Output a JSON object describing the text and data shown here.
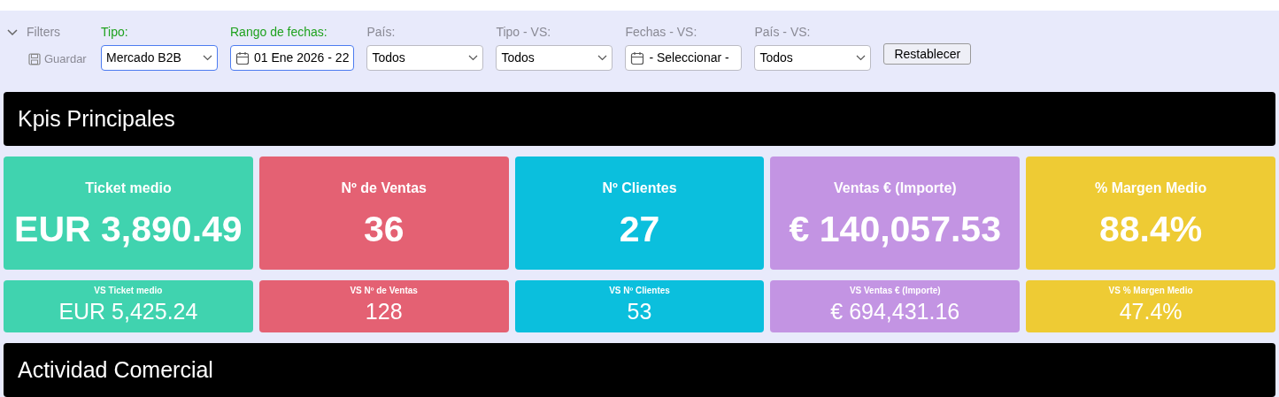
{
  "filters": {
    "toggle_label": "Filters",
    "save_label": "Guardar",
    "expanded": true,
    "fields": [
      {
        "kind": "select",
        "label": "Tipo:",
        "value": "Mercado B2B",
        "active": true
      },
      {
        "kind": "date",
        "label": "Rango de fechas:",
        "value": "01 Ene 2026 - 22",
        "active": true
      },
      {
        "kind": "select",
        "label": "País:",
        "value": "Todos",
        "active": false
      },
      {
        "kind": "select",
        "label": "Tipo - VS:",
        "value": "Todos",
        "active": false
      },
      {
        "kind": "date",
        "label": "Fechas - VS:",
        "value": "- Seleccionar -",
        "active": false
      },
      {
        "kind": "select",
        "label": "País - VS:",
        "value": "Todos",
        "active": false
      }
    ],
    "reset_button": "Restablecer"
  },
  "sections": [
    {
      "title": "Kpis Principales",
      "kpis": [
        {
          "title": "Ticket medio",
          "value": "EUR 3,890.49",
          "color": "#40d3af"
        },
        {
          "title": "Nº de Ventas",
          "value": "36",
          "color": "#e46173"
        },
        {
          "title": "Nº Clientes",
          "value": "27",
          "color": "#0bbfdd"
        },
        {
          "title": "Ventas € (Importe)",
          "value": "€ 140,057.53",
          "color": "#c394e3"
        },
        {
          "title": "% Margen Medio",
          "value": "88.4%",
          "color": "#eecb34"
        }
      ],
      "vs_kpis": [
        {
          "title": "VS Ticket medio",
          "value": "EUR 5,425.24",
          "color": "#40d3af"
        },
        {
          "title": "VS Nº de Ventas",
          "value": "128",
          "color": "#e46173"
        },
        {
          "title": "VS Nº Clientes",
          "value": "53",
          "color": "#0bbfdd"
        },
        {
          "title": "VS Ventas € (Importe)",
          "value": "€ 694,431.16",
          "color": "#c394e3"
        },
        {
          "title": "VS % Margen Medio",
          "value": "47.4%",
          "color": "#eecb34"
        }
      ]
    },
    {
      "title": "Actividad Comercial"
    }
  ]
}
